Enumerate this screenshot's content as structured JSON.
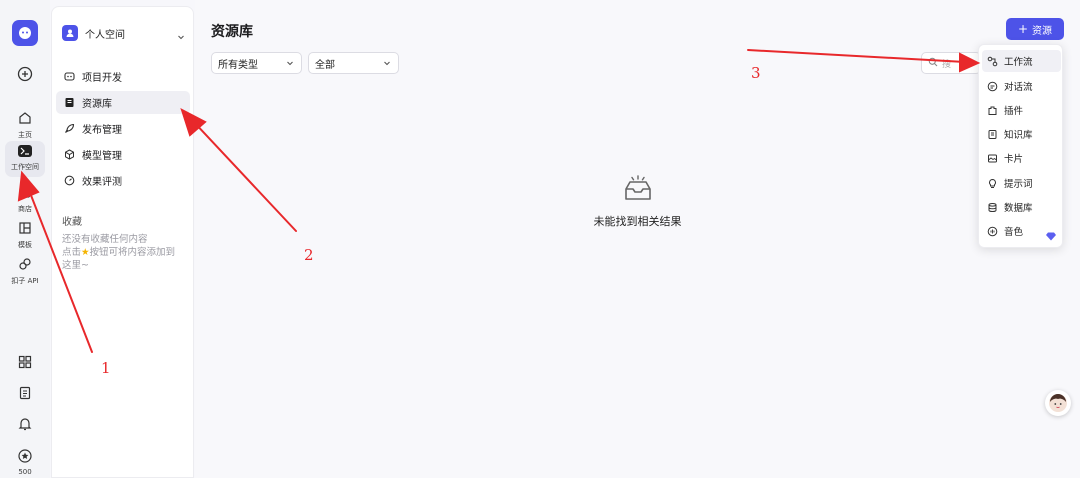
{
  "rail": {
    "logo": "coze-logo-icon",
    "items": [
      {
        "label": "主页",
        "icon": "home-icon"
      },
      {
        "label": "工作空间",
        "icon": "terminal-icon"
      },
      {
        "label": "商店",
        "icon": "store-icon"
      },
      {
        "label": "模板",
        "icon": "template-icon"
      },
      {
        "label": "扣子 API",
        "icon": "api-icon"
      }
    ],
    "credits": "500"
  },
  "sidebar": {
    "space_name": "个人空间",
    "items": [
      {
        "label": "项目开发",
        "icon": "project-icon"
      },
      {
        "label": "资源库",
        "icon": "library-icon"
      },
      {
        "label": "发布管理",
        "icon": "rocket-icon"
      },
      {
        "label": "模型管理",
        "icon": "cube-icon"
      },
      {
        "label": "效果评测",
        "icon": "gauge-icon"
      }
    ],
    "favorites_title": "收藏",
    "favorites_empty_1": "还没有收藏任何内容",
    "favorites_empty_2a": "点击",
    "favorites_empty_2b": "按钮可将内容添加到",
    "favorites_empty_3": "这里~"
  },
  "main": {
    "title": "资源库",
    "type_filter": "所有类型",
    "scope_filter": "全部",
    "search_placeholder": "搜",
    "add_button": "资源",
    "empty_text": "未能找到相关结果"
  },
  "menu": {
    "items": [
      {
        "label": "工作流",
        "icon": "workflow-icon"
      },
      {
        "label": "对话流",
        "icon": "chatflow-icon"
      },
      {
        "label": "插件",
        "icon": "plugin-icon"
      },
      {
        "label": "知识库",
        "icon": "knowledge-icon"
      },
      {
        "label": "卡片",
        "icon": "card-icon"
      },
      {
        "label": "提示词",
        "icon": "prompt-icon"
      },
      {
        "label": "数据库",
        "icon": "database-icon"
      },
      {
        "label": "音色",
        "icon": "voice-icon"
      }
    ]
  },
  "annotations": {
    "n1": "1",
    "n2": "2",
    "n3": "3"
  },
  "colors": {
    "accent": "#4d53e8",
    "annotation": "#e8282b"
  }
}
